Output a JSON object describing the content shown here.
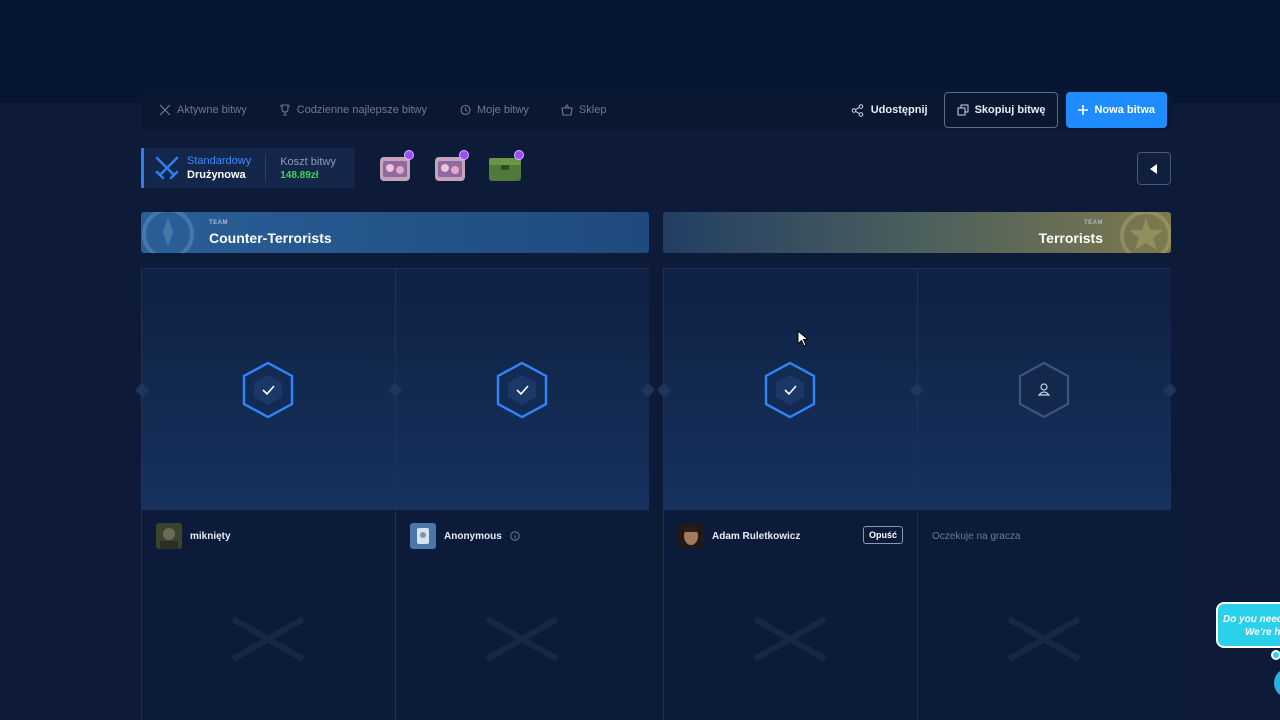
{
  "nav": {
    "items": [
      {
        "label": "Aktywne bitwy",
        "icon": "crossed-swords-icon"
      },
      {
        "label": "Codzienne najlepsze bitwy",
        "icon": "trophy-icon"
      },
      {
        "label": "Moje bitwy",
        "icon": "history-icon"
      },
      {
        "label": "Sklep",
        "icon": "basket-icon"
      }
    ],
    "share_label": "Udostępnij",
    "copy_label": "Skopiuj bitwę",
    "new_label": "Nowa bitwa"
  },
  "battle": {
    "mode_type": "Standardowy",
    "mode_sub": "Drużynowa",
    "cost_label": "Koszt bitwy",
    "cost_value": "148.89zł",
    "cases": [
      "case-1",
      "case-2",
      "case-3"
    ]
  },
  "teams": {
    "ct": {
      "small": "TEAM",
      "name": "Counter-Terrorists"
    },
    "t": {
      "small": "TEAM",
      "name": "Terrorists"
    }
  },
  "slots": [
    {
      "status": "ready",
      "player": "miknięty"
    },
    {
      "status": "ready",
      "player": "Anonymous"
    },
    {
      "status": "ready",
      "player": "Adam Ruletkowicz",
      "action": "Opuść"
    },
    {
      "status": "waiting",
      "player": "Oczekuje na gracza"
    }
  ],
  "chat": {
    "line1": "Do you need",
    "line2": "We're he"
  },
  "colors": {
    "accent": "#1e8cff",
    "cost": "#3cd65a",
    "ct": "#2b5f97",
    "t": "#7d7a4e",
    "chat": "#2bd0ea"
  }
}
